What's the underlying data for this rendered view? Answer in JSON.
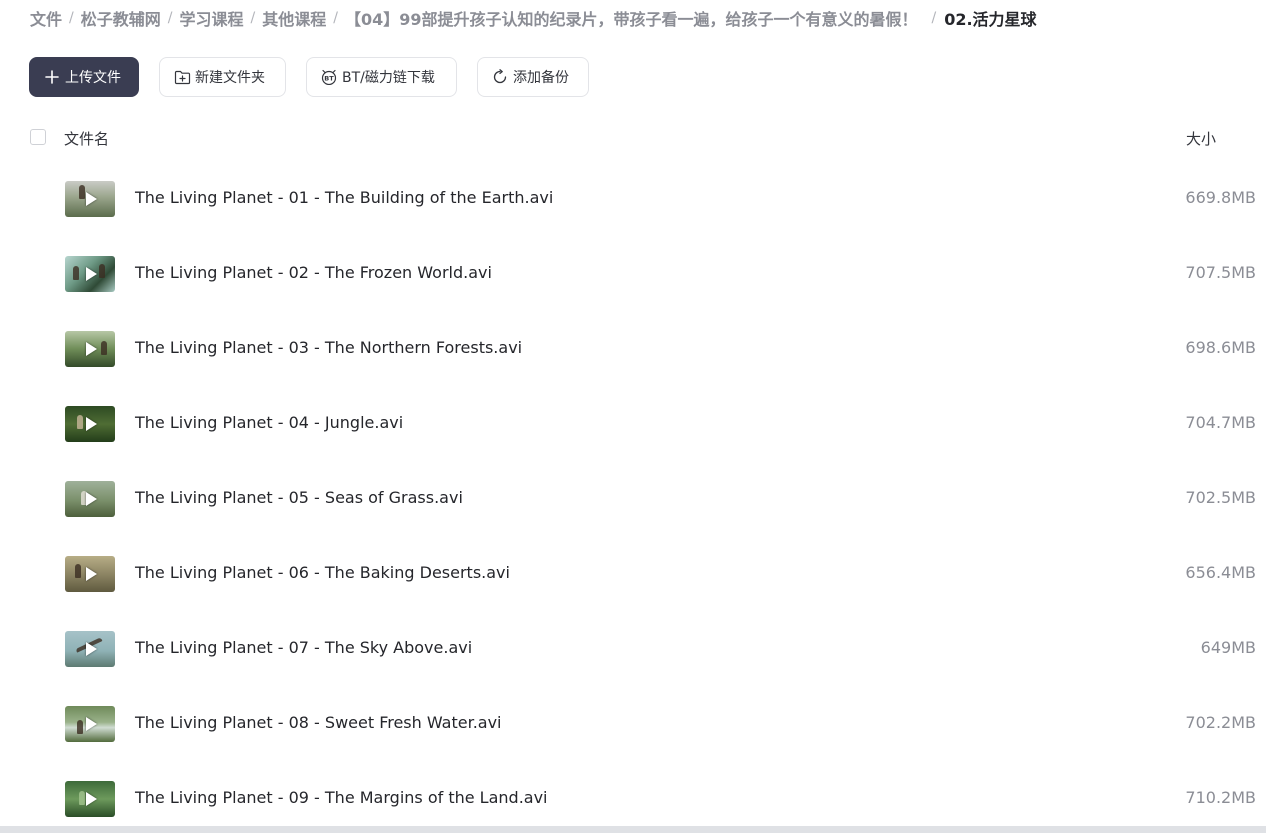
{
  "breadcrumb": {
    "items": [
      "文件",
      "松子教辅网",
      "学习课程",
      "其他课程",
      "【04】99部提升孩子认知的纪录片，带孩子看一遍，给孩子一个有意义的暑假！"
    ],
    "current": "02.活力星球",
    "separator": "/"
  },
  "toolbar": {
    "upload_label": "上传文件",
    "new_folder_label": "新建文件夹",
    "bt_label": "BT/磁力链下载",
    "backup_label": "添加备份"
  },
  "list_header": {
    "name_label": "文件名",
    "size_label": "大小"
  },
  "files": [
    {
      "name": "The Living Planet - 01 - The Building of the Earth.avi",
      "size": "669.8MB"
    },
    {
      "name": "The Living Planet - 02 - The Frozen World.avi",
      "size": "707.5MB"
    },
    {
      "name": "The Living Planet - 03 - The Northern Forests.avi",
      "size": "698.6MB"
    },
    {
      "name": "The Living Planet - 04 - Jungle.avi",
      "size": "704.7MB"
    },
    {
      "name": "The Living Planet - 05 - Seas of Grass.avi",
      "size": "702.5MB"
    },
    {
      "name": "The Living Planet - 06 - The Baking Deserts.avi",
      "size": "656.4MB"
    },
    {
      "name": "The Living Planet - 07 - The Sky Above.avi",
      "size": "649MB"
    },
    {
      "name": "The Living Planet - 08 - Sweet Fresh Water.avi",
      "size": "702.2MB"
    },
    {
      "name": "The Living Planet - 09 - The Margins of the Land.avi",
      "size": "710.2MB"
    }
  ],
  "colors": {
    "primary_button": "#3a3d52",
    "text": "#25262b",
    "muted": "#8b8d95"
  },
  "icons": {
    "upload": "plus-icon",
    "new_folder": "folder-plus-icon",
    "bt": "bt-icon",
    "backup": "refresh-icon",
    "file_thumb": "video-play-icon"
  }
}
